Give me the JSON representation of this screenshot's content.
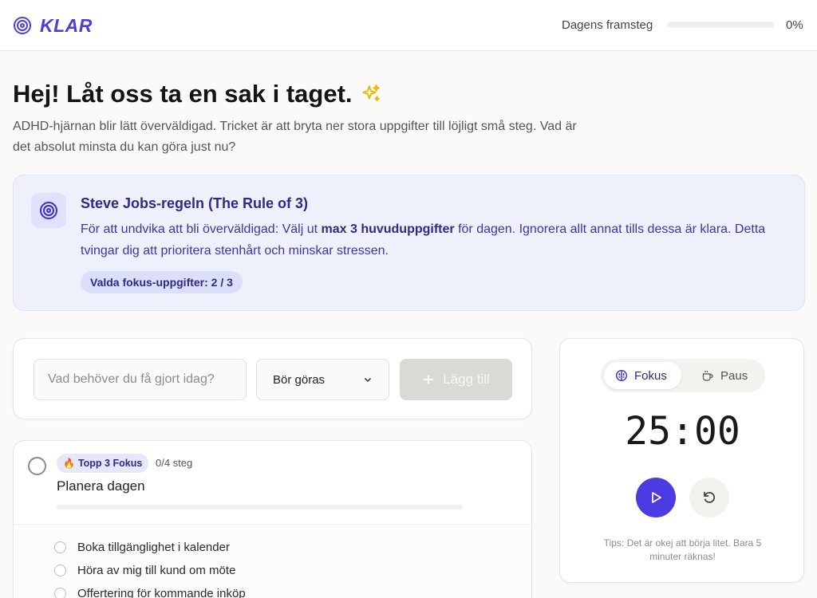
{
  "app": {
    "name": "KLAR",
    "accent": "#4a3fd8"
  },
  "header": {
    "progress_label": "Dagens framsteg",
    "progress_value_text": "0%",
    "progress_fraction": 0
  },
  "intro": {
    "title": "Hej! Låt oss ta en sak i taget.",
    "subtitle": "ADHD-hjärnan blir lätt överväldigad. Tricket är att bryta ner stora uppgifter till löjligt små steg. Vad är det absolut minsta du kan göra just nu?"
  },
  "rule": {
    "title": "Steve Jobs-regeln (The Rule of 3)",
    "text_before": "För att undvika att bli överväldigad: Välj ut ",
    "text_bold": "max 3 huvuduppgifter",
    "text_after": " för dagen. Ignorera allt annat tills dessa är klara. Detta tvingar dig att prioritera stenhårt och minskar stressen.",
    "badge": "Valda fokus-uppgifter: 2 / 3"
  },
  "add_task": {
    "input_placeholder": "Vad behöver du få gjort idag?",
    "input_value": "",
    "priority_selected": "Bör göras",
    "add_label": "Lägg till"
  },
  "task": {
    "badge": "Topp 3 Fokus",
    "steps": "0/4 steg",
    "title": "Planera dagen",
    "subtasks": [
      "Boka tillgänglighet i kalender",
      "Höra av mig till kund om möte",
      "Offertering för kommande inköp"
    ]
  },
  "timer": {
    "mode_focus": "Fokus",
    "mode_pause": "Paus",
    "time": "25:00",
    "tip": "Tips: Det är okej att börja litet. Bara 5 minuter räknas!"
  }
}
